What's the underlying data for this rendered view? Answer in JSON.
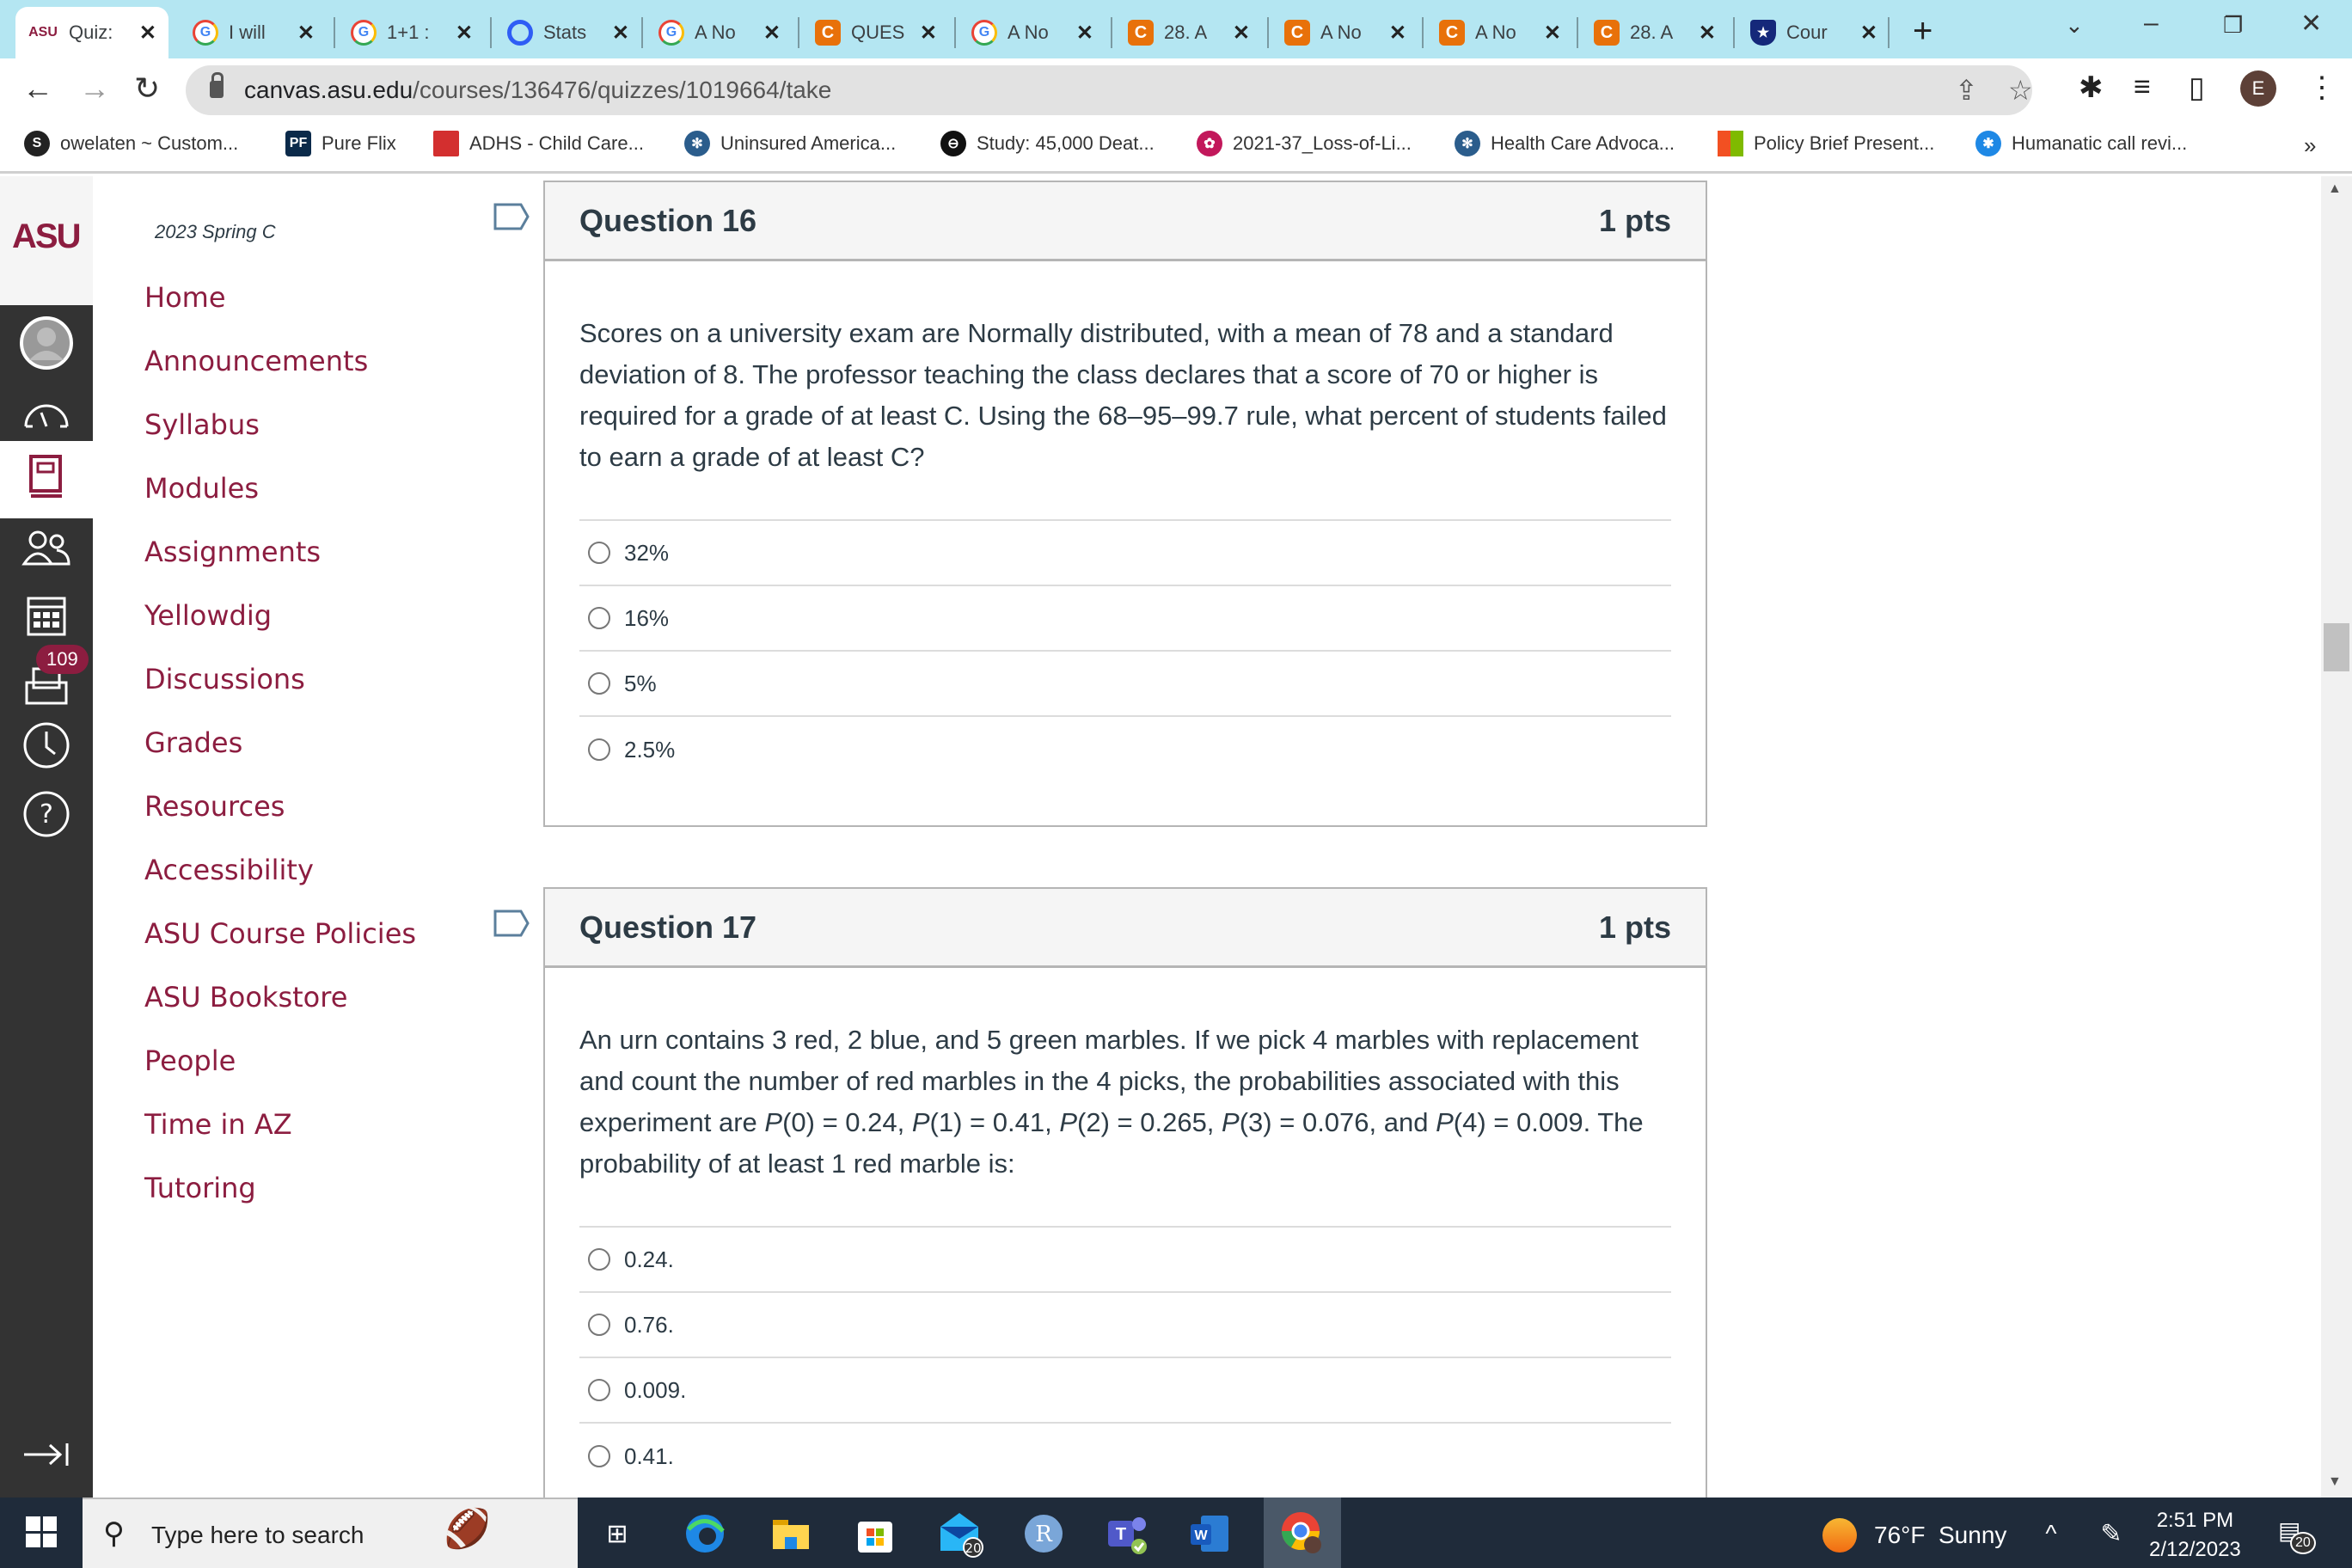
{
  "browser": {
    "tabs": [
      {
        "icon": "asu",
        "title": "Quiz:",
        "active": true
      },
      {
        "icon": "google",
        "title": "I will"
      },
      {
        "icon": "google",
        "title": "1+1 :"
      },
      {
        "icon": "quizlet",
        "title": "Stats"
      },
      {
        "icon": "google",
        "title": "A No"
      },
      {
        "icon": "chegg",
        "title": "QUES"
      },
      {
        "icon": "google",
        "title": "A No"
      },
      {
        "icon": "chegg",
        "title": "28. A"
      },
      {
        "icon": "chegg",
        "title": "A No"
      },
      {
        "icon": "chegg",
        "title": "A No"
      },
      {
        "icon": "chegg",
        "title": "28. A"
      },
      {
        "icon": "shield",
        "title": "Cour"
      }
    ],
    "new_tab": "+",
    "url_host": "canvas.asu.edu",
    "url_path": "/courses/136476/quizzes/1019664/take",
    "profile_initial": "E",
    "bookmarks": [
      {
        "label": "owelaten ~ Custom...",
        "icon_color": "#222"
      },
      {
        "label": "Pure Flix",
        "icon_color": "#0b2a4a"
      },
      {
        "label": "ADHS - Child Care...",
        "icon_color": "#d32f2f"
      },
      {
        "label": "Uninsured America...",
        "icon_color": "#2b5d8c"
      },
      {
        "label": "Study: 45,000 Deat...",
        "icon_color": "#111"
      },
      {
        "label": "2021-37_Loss-of-Li...",
        "icon_color": "#c2185b"
      },
      {
        "label": "Health Care Advoca...",
        "icon_color": "#2b5d8c"
      },
      {
        "label": "Policy Brief Present...",
        "icon_color": "#f25022"
      },
      {
        "label": "Humanatic call revi...",
        "icon_color": "#1e88e5"
      }
    ],
    "bookmarks_more": "»"
  },
  "global_nav": {
    "logo": "ASU",
    "inbox_badge": "109"
  },
  "course_nav": {
    "term": "2023 Spring C",
    "items": [
      "Home",
      "Announcements",
      "Syllabus",
      "Modules",
      "Assignments",
      "Yellowdig",
      "Discussions",
      "Grades",
      "Resources",
      "Accessibility",
      "ASU Course Policies",
      "ASU Bookstore",
      "People",
      "Time in AZ",
      "Tutoring"
    ]
  },
  "questions": [
    {
      "title": "Question 16",
      "points": "1 pts",
      "text": "Scores on a university exam are Normally distributed, with a mean of 78 and a standard deviation of 8. The professor teaching the class declares that a score of 70 or higher is required for a grade of at least C. Using the 68–95–99.7 rule, what percent of students failed to earn a grade of at least C?",
      "answers": [
        "32%",
        "16%",
        "5%",
        "2.5%"
      ]
    },
    {
      "title": "Question 17",
      "points": "1 pts",
      "text_parts": {
        "intro": "An urn contains 3 red, 2 blue, and 5 green marbles. If we pick 4 marbles with replacement and count the number of red marbles in the 4 picks, the probabilities associated with this experiment are ",
        "p0": "P",
        "v0": "(0) = 0.24, ",
        "p1": "P",
        "v1": "(1) = 0.41, ",
        "p2": "P",
        "v2": "(2) = 0.265, ",
        "p3": "P",
        "v3": "(3) = 0.076, and ",
        "p4": "P",
        "v4": "(4) = 0.009. The probability of at least 1 red marble is:"
      },
      "answers": [
        "0.24.",
        "0.76.",
        "0.009.",
        "0.41."
      ]
    }
  ],
  "taskbar": {
    "search_placeholder": "Type here to search",
    "mail_badge": "20",
    "weather": "76°F  Sunny",
    "time": "2:51 PM",
    "date": "2/12/2023",
    "notifications": "20"
  }
}
